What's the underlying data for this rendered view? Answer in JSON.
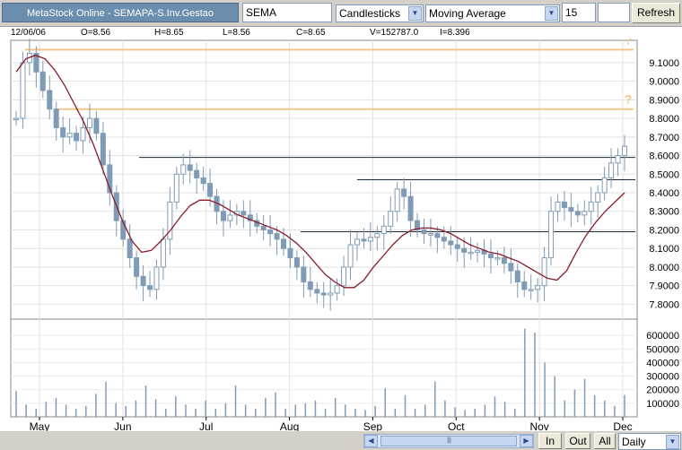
{
  "toolbar": {
    "title": "MetaStock Online - SEMAPA-S.Inv.Gestao",
    "symbol": "SEMA",
    "chart_type": "Candlesticks",
    "indicator": "Moving Average",
    "period": "15",
    "refresh_label": "Refresh"
  },
  "infobar": {
    "date": "12/06/06",
    "open": "O=8.56",
    "high": "H=8.65",
    "low": "L=8.56",
    "close": "C=8.65",
    "volume": "V=152787.0",
    "indicator_value": "I=8.396"
  },
  "bottom": {
    "in_label": "In",
    "out_label": "Out",
    "all_label": "All",
    "interval": "Daily"
  },
  "icons": {
    "dropdown": "chevron-down-icon",
    "scroll_left": "arrow-left-icon",
    "scroll_right": "arrow-right-icon",
    "question_marks": "question-icon"
  },
  "colors": {
    "candle": "#7f9bb5",
    "moving_average": "#8b1a2a",
    "projection_lines": "#f5c48a",
    "resistance_lines": "#1a2a3a",
    "title_bg": "#6b8eae"
  },
  "chart_data": {
    "type": "candlestick",
    "price_axis": {
      "ticks": [
        "9.1000",
        "9.0000",
        "8.9000",
        "8.8000",
        "8.7000",
        "8.6000",
        "8.5000",
        "8.4000",
        "8.3000",
        "8.2000",
        "8.1000",
        "8.0000",
        "7.9000",
        "7.8000"
      ],
      "range": [
        7.72,
        9.22
      ]
    },
    "volume_axis": {
      "ticks": [
        "600000",
        "500000",
        "400000",
        "300000",
        "200000",
        "100000"
      ],
      "range": [
        0,
        680000
      ]
    },
    "x_labels": [
      "May",
      "Jun",
      "Jul",
      "Aug",
      "Sep",
      "Oct",
      "Nov",
      "Dec"
    ],
    "horizontal_levels": [
      {
        "value": 9.17,
        "style": "projection",
        "marker": "?"
      },
      {
        "value": 8.85,
        "style": "projection",
        "marker": "?"
      },
      {
        "value": 8.59
      },
      {
        "value": 8.47
      },
      {
        "value": 8.19
      }
    ],
    "closes": [
      8.8,
      9.1,
      9.15,
      9.05,
      8.95,
      8.85,
      8.75,
      8.7,
      8.72,
      8.68,
      8.75,
      8.8,
      8.72,
      8.55,
      8.4,
      8.25,
      8.15,
      8.05,
      7.95,
      7.9,
      7.88,
      8.0,
      8.15,
      8.35,
      8.5,
      8.55,
      8.52,
      8.48,
      8.45,
      8.38,
      8.3,
      8.25,
      8.28,
      8.3,
      8.28,
      8.25,
      8.22,
      8.2,
      8.18,
      8.15,
      8.1,
      8.05,
      8.0,
      7.92,
      7.88,
      7.86,
      7.85,
      7.86,
      7.9,
      8.0,
      8.12,
      8.15,
      8.14,
      8.16,
      8.18,
      8.22,
      8.3,
      8.42,
      8.38,
      8.25,
      8.2,
      8.18,
      8.18,
      8.16,
      8.14,
      8.12,
      8.1,
      8.08,
      8.08,
      8.09,
      8.07,
      8.05,
      8.05,
      8.02,
      7.98,
      7.92,
      7.88,
      7.88,
      7.9,
      8.05,
      8.3,
      8.35,
      8.32,
      8.3,
      8.28,
      8.3,
      8.35,
      8.4,
      8.48,
      8.56,
      8.6,
      8.65
    ],
    "moving_average": [
      9.05,
      9.12,
      9.14,
      9.12,
      9.06,
      8.98,
      8.88,
      8.78,
      8.66,
      8.52,
      8.38,
      8.25,
      8.14,
      8.08,
      8.09,
      8.14,
      8.2,
      8.27,
      8.33,
      8.36,
      8.36,
      8.34,
      8.31,
      8.28,
      8.26,
      8.24,
      8.22,
      8.2,
      8.17,
      8.13,
      8.08,
      8.02,
      7.96,
      7.92,
      7.89,
      7.89,
      7.93,
      8.0,
      8.06,
      8.12,
      8.17,
      8.2,
      8.21,
      8.21,
      8.2,
      8.18,
      8.15,
      8.12,
      8.1,
      8.08,
      8.07,
      8.05,
      8.03,
      8.0,
      7.97,
      7.94,
      7.93,
      7.98,
      8.08,
      8.17,
      8.24,
      8.3,
      8.35,
      8.4
    ],
    "volumes": [
      190000,
      90000,
      60000,
      110000,
      140000,
      90000,
      60000,
      80000,
      170000,
      260000,
      100000,
      80000,
      120000,
      230000,
      130000,
      60000,
      150000,
      90000,
      60000,
      120000,
      60000,
      100000,
      230000,
      90000,
      60000,
      140000,
      180000,
      60000,
      90000,
      100000,
      120000,
      60000,
      140000,
      90000,
      60000,
      50000,
      80000,
      210000,
      60000,
      160000,
      60000,
      90000,
      260000,
      120000,
      70000,
      50000,
      60000,
      90000,
      150000,
      110000,
      60000,
      650000,
      620000,
      400000,
      300000,
      120000,
      200000,
      280000,
      160000,
      120000,
      80000,
      160000
    ]
  }
}
